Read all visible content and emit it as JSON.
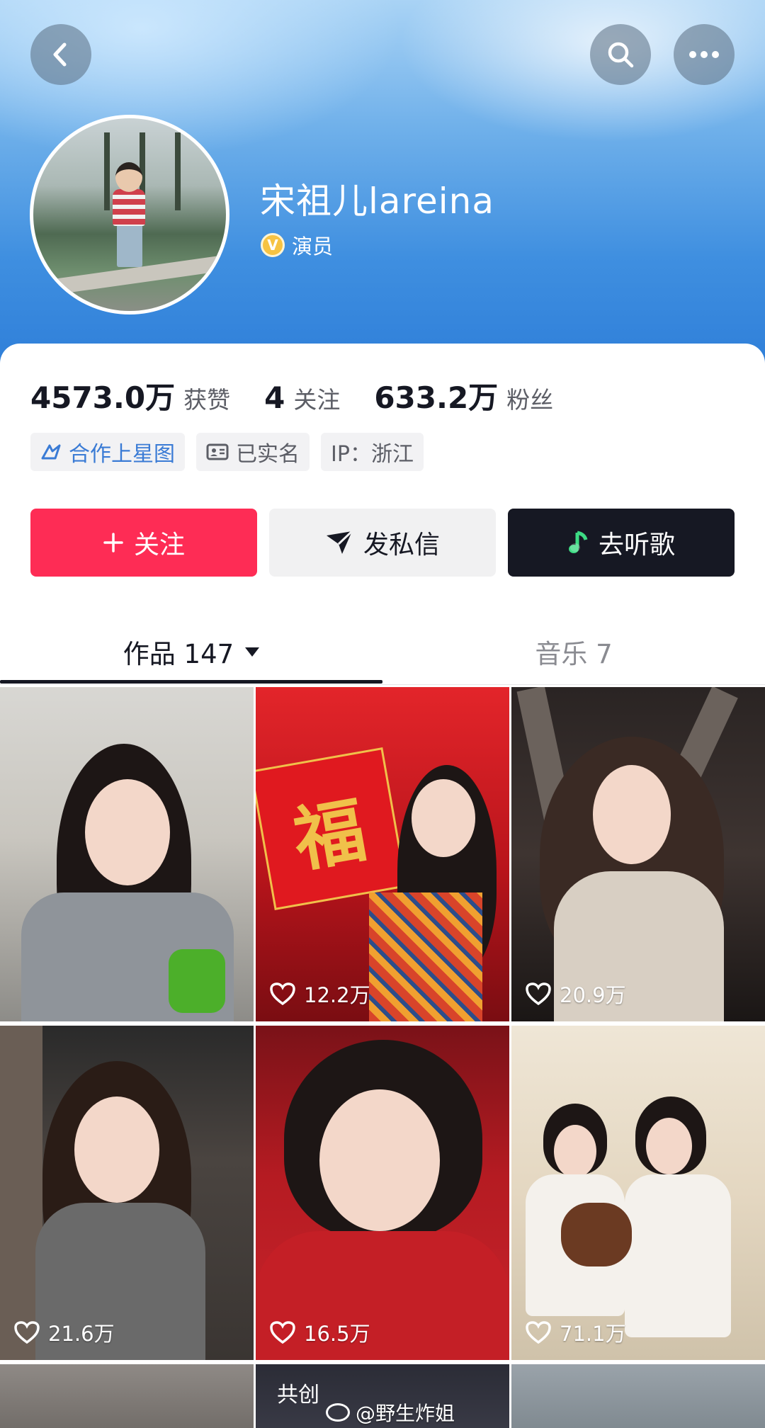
{
  "profile": {
    "name": "宋祖儿lareina",
    "verified_badge": "V",
    "role": "演员",
    "avatar_icon": "profile-avatar"
  },
  "stats": [
    {
      "value": "4573.0万",
      "label": "获赞"
    },
    {
      "value": "4",
      "label": "关注"
    },
    {
      "value": "633.2万",
      "label": "粉丝"
    }
  ],
  "tags": [
    {
      "label": "合作上星图",
      "icon": "star-map-icon"
    },
    {
      "label": "已实名",
      "icon": "id-card-icon"
    },
    {
      "label": "IP：浙江",
      "icon": ""
    }
  ],
  "actions": {
    "follow_label": "关注",
    "message_label": "发私信",
    "music_label": "去听歌"
  },
  "tabs": [
    {
      "label": "作品 147",
      "active": true
    },
    {
      "label": "音乐 7",
      "active": false
    }
  ],
  "posts": [
    {
      "likes": ""
    },
    {
      "likes": "12.2万"
    },
    {
      "likes": "20.9万"
    },
    {
      "likes": "21.6万"
    },
    {
      "likes": "16.5万"
    },
    {
      "likes": "71.1万"
    }
  ],
  "partial_row": {
    "collab_label": "共创"
  },
  "watermark": "@野生炸姐",
  "colors": {
    "follow_button": "#fe2c55",
    "music_button": "#161823",
    "tag_blue": "#3a7bd5"
  }
}
